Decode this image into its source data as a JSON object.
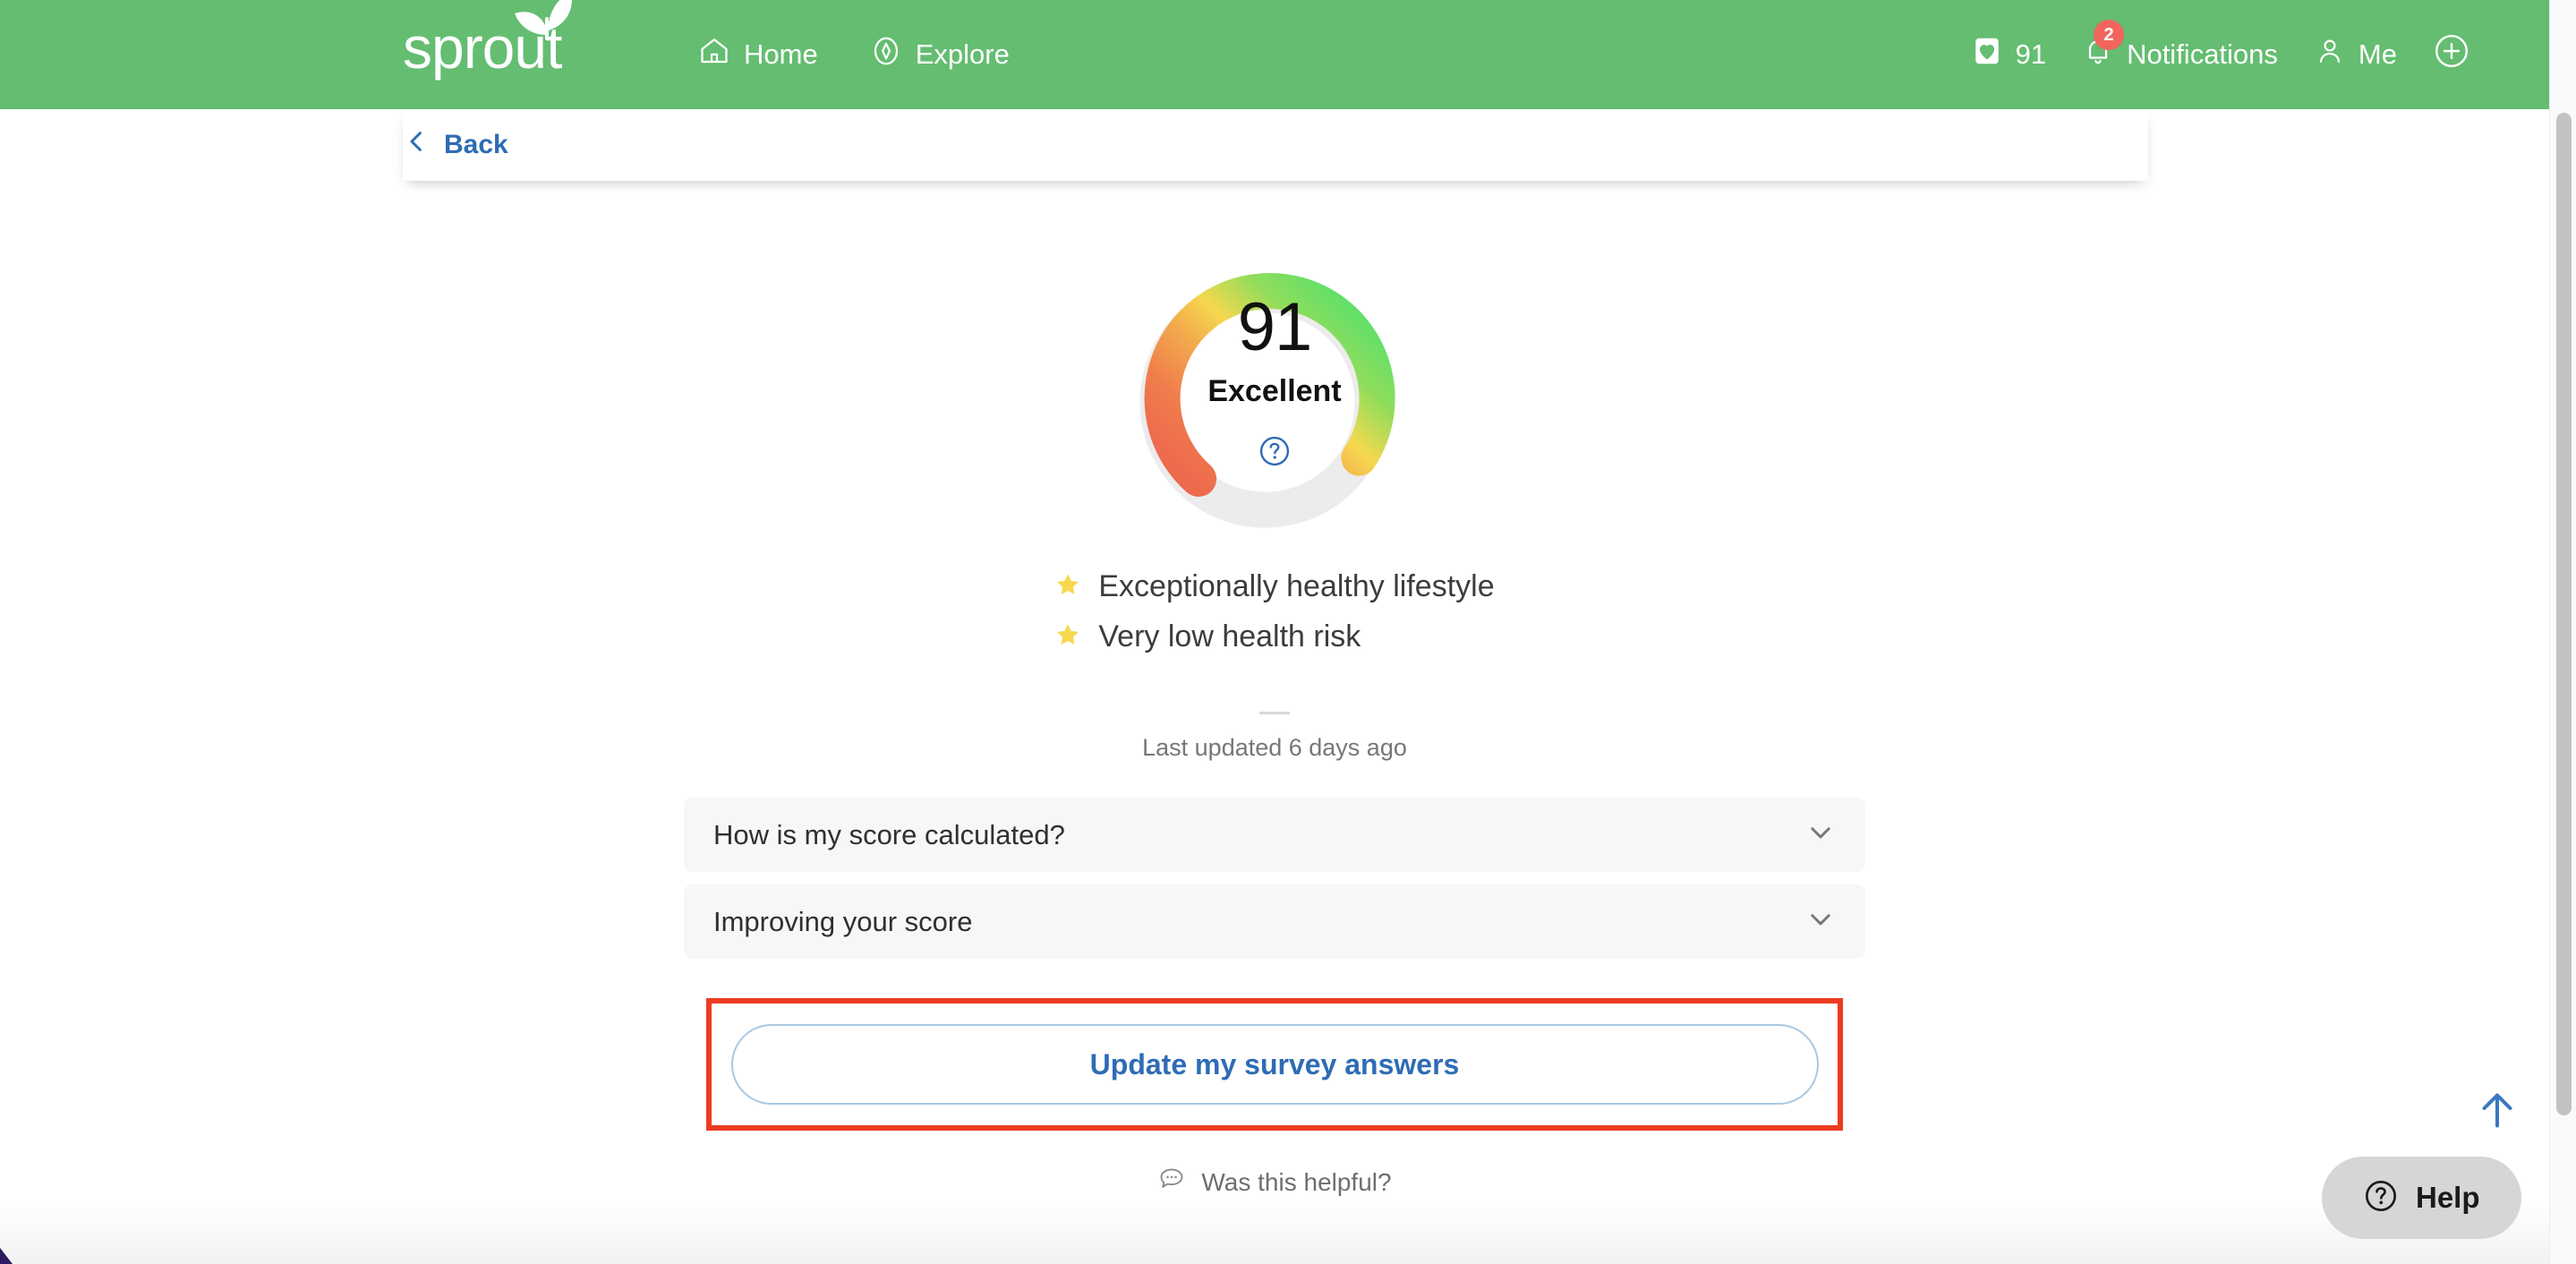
{
  "header": {
    "brand": "sprout",
    "nav": [
      {
        "label": "Home",
        "icon": "home-icon"
      },
      {
        "label": "Explore",
        "icon": "compass-icon"
      }
    ],
    "score_pill": {
      "value": "91",
      "icon": "heart-card-icon"
    },
    "notifications": {
      "label": "Notifications",
      "badge": "2",
      "icon": "bell-icon"
    },
    "me": {
      "label": "Me",
      "icon": "person-icon"
    },
    "add": {
      "icon": "plus-circle-icon"
    },
    "brand_color": "#64bd71",
    "badge_color": "#f2655c"
  },
  "backbar": {
    "label": "Back",
    "icon": "chevron-left-icon"
  },
  "gauge": {
    "score": "91",
    "rating": "Excellent",
    "help_icon": "question-circle-icon",
    "min": 0,
    "max": 100,
    "colors": {
      "start": "#ee6a4d",
      "mid": "#f5d84e",
      "end": "#5ee06a",
      "track": "#ececec",
      "help": "#2e6cb5"
    }
  },
  "highlights": [
    {
      "icon": "star-icon",
      "text": "Exceptionally healthy lifestyle"
    },
    {
      "icon": "star-icon",
      "text": "Very low health risk"
    }
  ],
  "updated": "Last updated 6 days ago",
  "accordions": [
    {
      "title": "How is my score calculated?",
      "icon": "chevron-down-icon"
    },
    {
      "title": "Improving your score",
      "icon": "chevron-down-icon"
    }
  ],
  "cta": {
    "label": "Update my survey answers",
    "highlight_color": "#eb3c21"
  },
  "helpful": {
    "label": "Was this helpful?",
    "icon": "speech-bubble-icon"
  },
  "scroll_top": {
    "icon": "arrow-up-icon"
  },
  "help_widget": {
    "label": "Help",
    "icon": "question-circle-icon"
  },
  "chart_data": {
    "type": "gauge",
    "title": "Health score",
    "value": 91,
    "min": 0,
    "max": 100,
    "label": "Excellent",
    "filled_fraction": 0.91,
    "gradient_stops": [
      "#ee6a4d",
      "#f0a04a",
      "#f5d84e",
      "#8fdc5c",
      "#5ee06a"
    ],
    "track_color": "#ececec"
  }
}
